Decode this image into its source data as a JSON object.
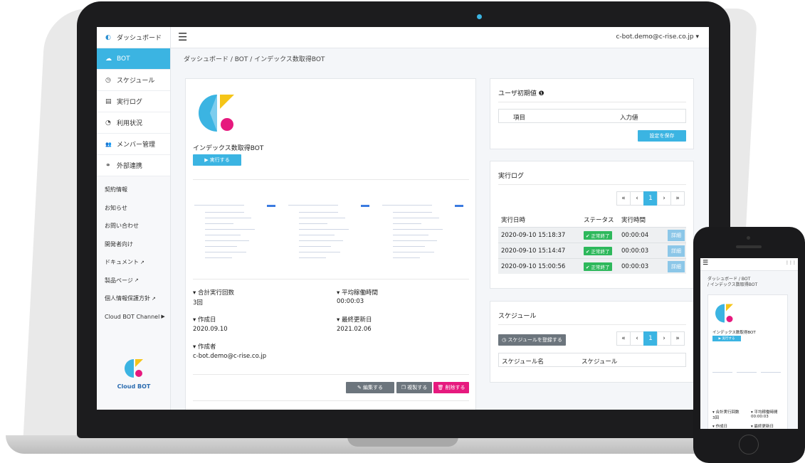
{
  "sidebar": {
    "items": [
      {
        "icon": "dashboard-icon",
        "glyph": "◐",
        "label": "ダッシュボード"
      },
      {
        "icon": "bot-icon",
        "glyph": "☁",
        "label": "BOT"
      },
      {
        "icon": "clock-icon",
        "glyph": "◷",
        "label": "スケジュール"
      },
      {
        "icon": "file-icon",
        "glyph": "▤",
        "label": "実行ログ"
      },
      {
        "icon": "pie-chart-icon",
        "glyph": "◔",
        "label": "利用状況"
      },
      {
        "icon": "users-icon",
        "glyph": "👥",
        "label": "メンバー管理"
      },
      {
        "icon": "link-icon",
        "glyph": "⚭",
        "label": "外部連携"
      }
    ],
    "sub_items": [
      {
        "label": "契約情報",
        "ext": ""
      },
      {
        "label": "お知らせ",
        "ext": ""
      },
      {
        "label": "お問い合わせ",
        "ext": ""
      },
      {
        "label": "開発者向け",
        "ext": ""
      },
      {
        "label": "ドキュメント",
        "ext": "↗"
      },
      {
        "label": "製品ページ",
        "ext": "↗"
      },
      {
        "label": "個人情報保護方針",
        "ext": "↗"
      },
      {
        "label": "Cloud BOT Channel",
        "ext": "▶"
      }
    ],
    "logo_text": "Cloud BOT"
  },
  "header": {
    "menu_glyph": "☰",
    "user": "c-bot.demo@c-rise.co.jp ▾"
  },
  "breadcrumb": "ダッシュボード  /  BOT  /  インデックス数取得BOT",
  "bot": {
    "name": "インデックス数取得BOT",
    "run_label": "▶ 実行する",
    "stats": {
      "total_runs_label": "▾ 合計実行回数",
      "total_runs": "3回",
      "avg_time_label": "▾ 平均稼働時間",
      "avg_time": "00:00:03",
      "created_label": "▾ 作成日",
      "created": "2020.09.10",
      "updated_label": "▾ 最終更新日",
      "updated": "2021.02.06",
      "author_label": "▾ 作成者",
      "author": "c-bot.demo@c-rise.co.jp"
    },
    "edit_label": "✎ 編集する",
    "copy_label": "❐ 複製する",
    "delete_label": "🗑 削除する"
  },
  "user_defaults": {
    "title": "ユーザ初期値 ❶",
    "col_item": "項目",
    "col_value": "入力値",
    "save_label": "設定を保存"
  },
  "exec_log": {
    "title": "実行ログ",
    "pager": [
      "«",
      "‹",
      "1",
      "›",
      "»"
    ],
    "col_date": "実行日時",
    "col_status": "ステータス",
    "col_time": "実行時間",
    "rows": [
      {
        "date": "2020-09-10 15:18:37",
        "status": "✔ 正常終了",
        "time": "00:00:04",
        "detail": "詳細"
      },
      {
        "date": "2020-09-10 15:14:47",
        "status": "✔ 正常終了",
        "time": "00:00:03",
        "detail": "詳細"
      },
      {
        "date": "2020-09-10 15:00:56",
        "status": "✔ 正常終了",
        "time": "00:00:03",
        "detail": "詳細"
      }
    ]
  },
  "schedule": {
    "title": "スケジュール",
    "register_label": "◷ スケジュールを登録する",
    "pager": [
      "«",
      "‹",
      "1",
      "›",
      "»"
    ],
    "col_name": "スケジュール名",
    "col_schedule": "スケジュール"
  },
  "phone": {
    "menu_glyph": "☰",
    "grid_glyph": "⋮⋮⋮",
    "crumb1": "ダッシュボード  /  BOT",
    "crumb2": "/ インデックス数取得BOT",
    "bot_name": "インデックス数取得BOT",
    "run_label": "▶ 実行する",
    "total_runs_label": "▾ 合計実行回数",
    "total_runs": "3回",
    "avg_time_label": "▾ 平均稼働時間",
    "avg_time": "00:00:03",
    "created_label": "▾ 作成日",
    "updated_label": "▾ 最終更新日"
  },
  "colors": {
    "accent": "#3bb4e2",
    "success": "#2eb85c",
    "danger": "#e6197e",
    "muted": "#6c757d"
  }
}
